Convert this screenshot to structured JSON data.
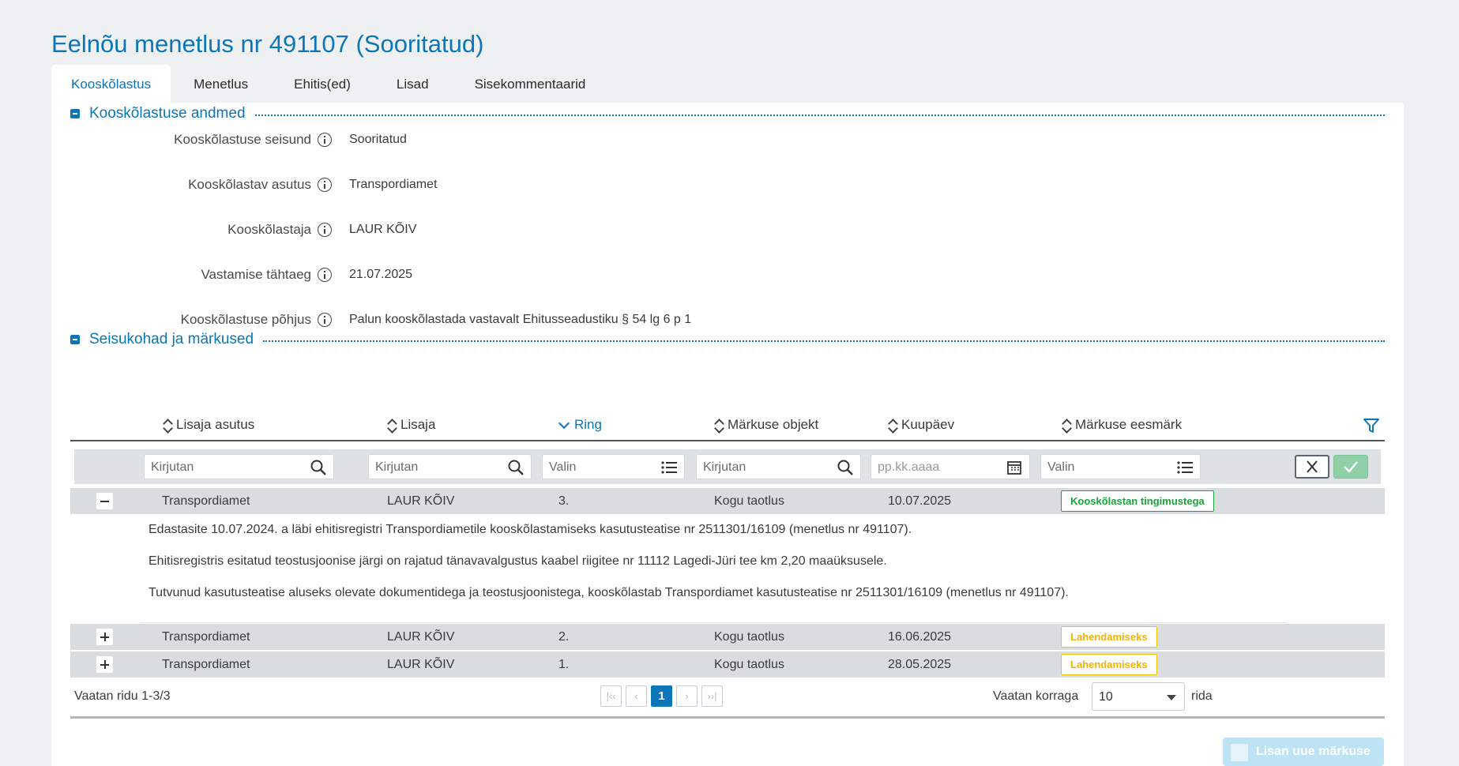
{
  "page_title": "Eelnõu menetlus nr 491107 (Sooritatud)",
  "tabs": [
    {
      "label": "Kooskõlastus",
      "active": true
    },
    {
      "label": "Menetlus",
      "active": false
    },
    {
      "label": "Ehitis(ed)",
      "active": false
    },
    {
      "label": "Lisad",
      "active": false
    },
    {
      "label": "Sisekommentaarid",
      "active": false
    }
  ],
  "section_details": {
    "title": "Kooskõlastuse andmed",
    "fields": [
      {
        "label": "Kooskõlastuse seisund",
        "value": "Sooritatud"
      },
      {
        "label": "Kooskõlastav asutus",
        "value": "Transpordiamet"
      },
      {
        "label": "Kooskõlastaja",
        "value": "LAUR KÕIV"
      },
      {
        "label": "Vastamise tähtaeg",
        "value": "21.07.2025"
      },
      {
        "label": "Kooskõlastuse põhjus",
        "value": "Palun kooskõlastada vastavalt Ehitusseadustiku § 54 lg 6 p 1"
      }
    ]
  },
  "section_remarks": {
    "title": "Seisukohad ja märkused",
    "columns": [
      {
        "label": "Lisaja asutus",
        "sort": "none"
      },
      {
        "label": "Lisaja",
        "sort": "none"
      },
      {
        "label": "Ring",
        "sort": "desc"
      },
      {
        "label": "Märkuse objekt",
        "sort": "none"
      },
      {
        "label": "Kuupäev",
        "sort": "none"
      },
      {
        "label": "Märkuse eesmärk",
        "sort": "none"
      }
    ],
    "filters": {
      "lisaja_asutus": "Kirjutan",
      "lisaja": "Kirjutan",
      "ring": "Valin",
      "markuse_objekt": "Kirjutan",
      "kuupaev": "pp.kk.aaaa",
      "markuse_eesmark": "Valin"
    },
    "rows": [
      {
        "expanded": true,
        "asutus": "Transpordiamet",
        "lisaja": "LAUR KÕIV",
        "ring": "3.",
        "objekt": "Kogu taotlus",
        "kuupaev": "10.07.2025",
        "eesmark": "Kooskõlastan tingimustega",
        "eesmark_color": "#1aa33a",
        "details": [
          "Edastasite 10.07.2024. a läbi ehitisregistri Transpordiametile kooskõlastamiseks kasutusteatise nr 2511301/16109 (menetlus nr 491107).",
          "Ehitisregistris esitatud teostusjoonise järgi on rajatud tänavavalgustus kaabel riigitee nr 11112 Lagedi-Jüri tee km 2,20 maaüksusele.",
          "Tutvunud kasutusteatise aluseks olevate dokumentidega ja teostusjoonistega, kooskõlastab Transpordiamet kasutusteatise nr 2511301/16109 (menetlus nr 491107)."
        ]
      },
      {
        "expanded": false,
        "asutus": "Transpordiamet",
        "lisaja": "LAUR KÕIV",
        "ring": "2.",
        "objekt": "Kogu taotlus",
        "kuupaev": "16.06.2025",
        "eesmark": "Lahendamiseks",
        "eesmark_color": "#f0b400"
      },
      {
        "expanded": false,
        "asutus": "Transpordiamet",
        "lisaja": "LAUR KÕIV",
        "ring": "1.",
        "objekt": "Kogu taotlus",
        "kuupaev": "28.05.2025",
        "eesmark": "Lahendamiseks",
        "eesmark_color": "#f0b400"
      }
    ],
    "footer": {
      "range_text": "Vaatan ridu 1-3/3",
      "current_page": "1",
      "pager_first": "|‹‹",
      "pager_prev": "‹",
      "pager_next": "›",
      "pager_last": "››|",
      "per_page_label": "Vaatan korraga",
      "per_page_value": "10",
      "per_page_suffix": "rida"
    }
  },
  "add_button_label": "Lisan uue märkuse",
  "colors": {
    "accent": "#0b76b8",
    "success": "#1aa33a",
    "warning": "#f0b400"
  }
}
